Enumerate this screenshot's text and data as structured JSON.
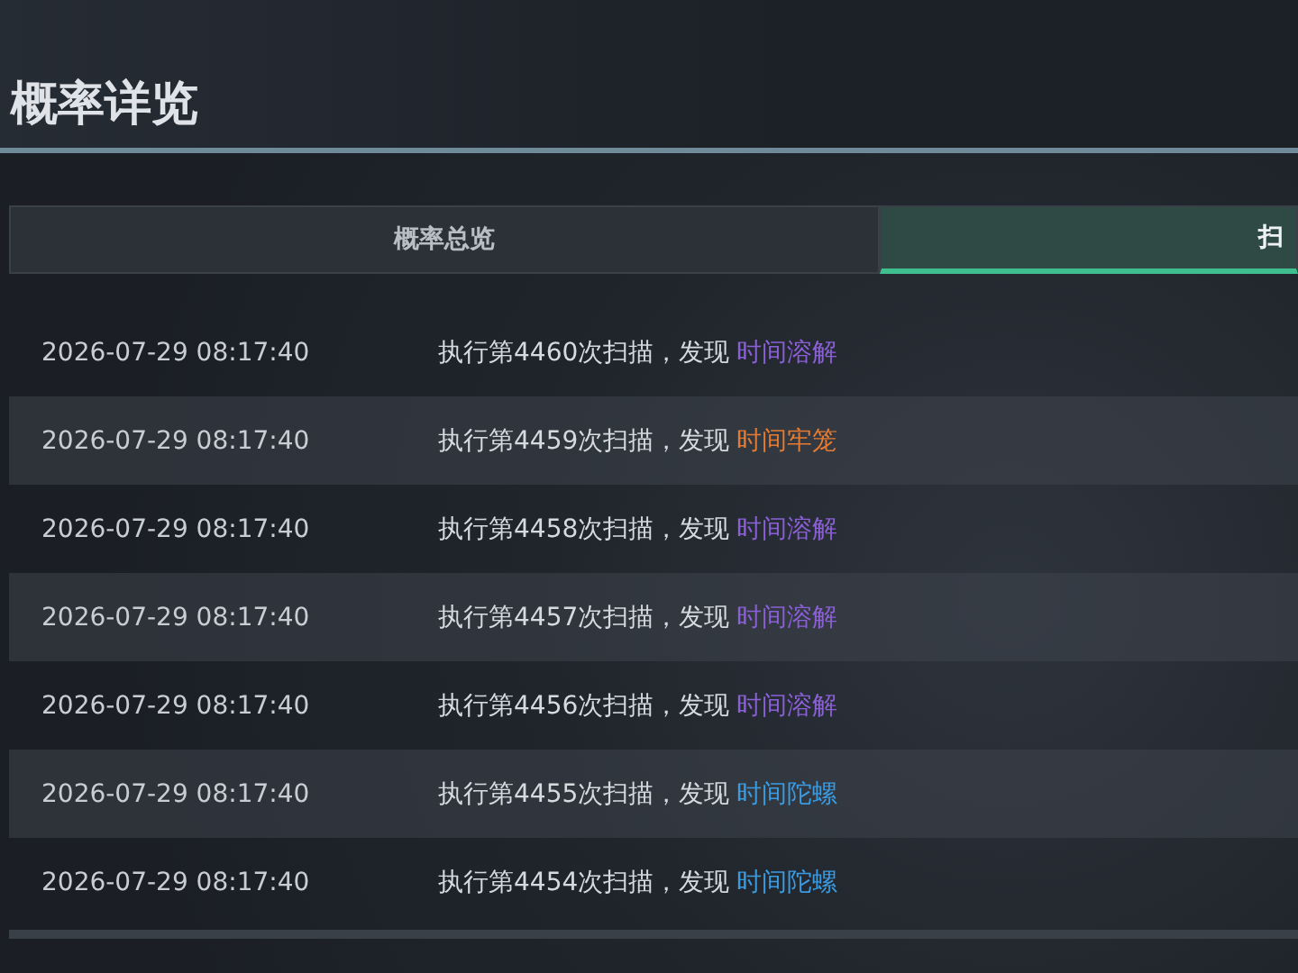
{
  "title": "概率详览",
  "tabs": [
    {
      "label": "概率总览",
      "selected": false
    },
    {
      "label": "扫",
      "selected": true
    }
  ],
  "log": [
    {
      "time": "2026-07-29 08:17:40",
      "message": "执行第4460次扫描，发现",
      "finding": "时间溶解",
      "color": "#8b5fd6"
    },
    {
      "time": "2026-07-29 08:17:40",
      "message": "执行第4459次扫描，发现",
      "finding": "时间牢笼",
      "color": "#e57b32"
    },
    {
      "time": "2026-07-29 08:17:40",
      "message": "执行第4458次扫描，发现",
      "finding": "时间溶解",
      "color": "#8b5fd6"
    },
    {
      "time": "2026-07-29 08:17:40",
      "message": "执行第4457次扫描，发现",
      "finding": "时间溶解",
      "color": "#8b5fd6"
    },
    {
      "time": "2026-07-29 08:17:40",
      "message": "执行第4456次扫描，发现",
      "finding": "时间溶解",
      "color": "#8b5fd6"
    },
    {
      "time": "2026-07-29 08:17:40",
      "message": "执行第4455次扫描，发现",
      "finding": "时间陀螺",
      "color": "#3b9be0"
    },
    {
      "time": "2026-07-29 08:17:40",
      "message": "执行第4454次扫描，发现",
      "finding": "时间陀螺",
      "color": "#3b9be0"
    }
  ]
}
